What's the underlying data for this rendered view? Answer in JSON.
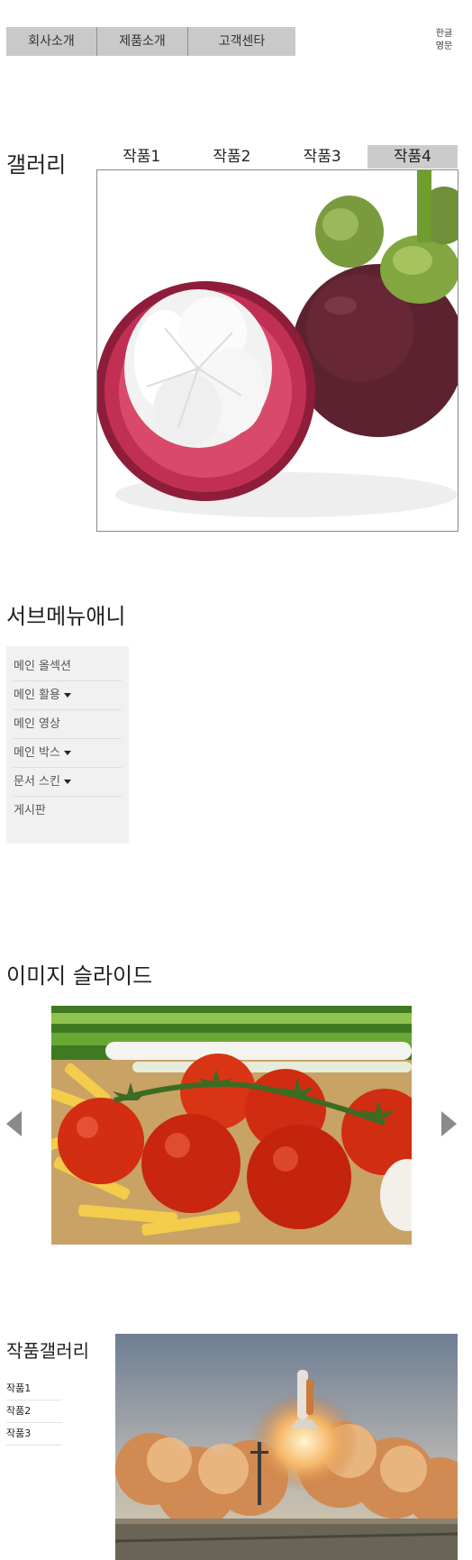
{
  "top_nav": {
    "items": [
      "회사소개",
      "제품소개",
      "고객센타"
    ]
  },
  "lang": {
    "korean": "한글",
    "english": "영문"
  },
  "gallery": {
    "title": "갤러리",
    "tabs": [
      "작품1",
      "작품2",
      "작품3",
      "작품4"
    ],
    "active_tab": "작품4"
  },
  "submenu": {
    "title": "서브메뉴애니",
    "items": [
      {
        "label": "메인 올섹션",
        "has_sub": false
      },
      {
        "label": "메인 활용",
        "has_sub": true
      },
      {
        "label": "메인 영상",
        "has_sub": false
      },
      {
        "label": "메인 박스",
        "has_sub": true
      },
      {
        "label": "문서 스킨",
        "has_sub": true
      },
      {
        "label": "게시판",
        "has_sub": false
      }
    ]
  },
  "image_slide": {
    "title": "이미지 슬라이드"
  },
  "work_gallery": {
    "title": "작품갤러리",
    "items": [
      "작품1",
      "작품2",
      "작품3"
    ]
  },
  "colors": {
    "nav_bg": "#c9c9c9",
    "tab_active_bg": "#cccccc",
    "submenu_bg": "#f1f1f1",
    "arrow": "#8a8a8a"
  },
  "icons": [
    "caret-down-icon",
    "arrow-left-icon",
    "arrow-right-icon"
  ]
}
